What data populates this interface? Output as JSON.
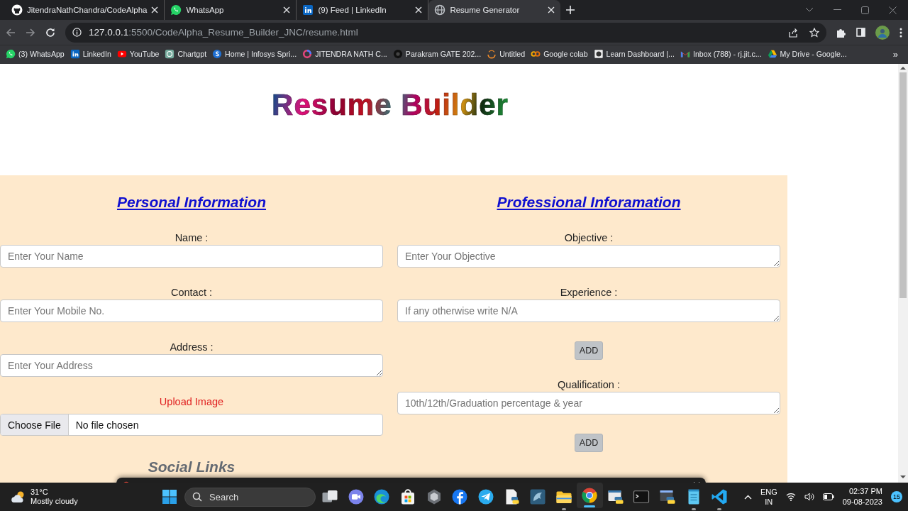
{
  "browser": {
    "tabs": [
      {
        "title": "JitendraNathChandra/CodeAlpha",
        "kind": "github",
        "selected": false
      },
      {
        "title": "WhatsApp",
        "kind": "whatsapp",
        "selected": false
      },
      {
        "title": "(9) Feed | LinkedIn",
        "kind": "linkedin",
        "selected": false
      },
      {
        "title": "Resume Generator",
        "kind": "globe",
        "selected": true
      }
    ],
    "address": {
      "host": "127.0.0.1",
      "path": ":5500/CodeAlpha_Resume_Builder_JNC/resume.html"
    },
    "bookmarks": [
      {
        "label": "(3) WhatsApp",
        "kind": "whatsapp"
      },
      {
        "label": "LinkedIn",
        "kind": "linkedin"
      },
      {
        "label": "YouTube",
        "kind": "youtube"
      },
      {
        "label": "Chartgpt",
        "kind": "chatgpt"
      },
      {
        "label": "Home | Infosys Spri...",
        "kind": "infosys"
      },
      {
        "label": "JITENDRA NATH C...",
        "kind": "ring"
      },
      {
        "label": "Parakram GATE 202...",
        "kind": "dark"
      },
      {
        "label": "Untitled",
        "kind": "arc"
      },
      {
        "label": "Google colab",
        "kind": "colab"
      },
      {
        "label": "Learn Dashboard |...",
        "kind": "learn"
      },
      {
        "label": "Inbox (788) - rj.jit.c...",
        "kind": "gmail"
      },
      {
        "label": "My Drive - Google...",
        "kind": "drive"
      }
    ],
    "more": "»"
  },
  "page": {
    "title": "Resume Builder",
    "columns": [
      {
        "heading": "Personal Information",
        "fields": [
          {
            "kind": "input",
            "label": "Name :",
            "placeholder": "Enter Your Name"
          },
          {
            "kind": "input",
            "label": "Contact :",
            "placeholder": "Enter Your Mobile No."
          },
          {
            "kind": "textarea",
            "label": "Address :",
            "placeholder": "Enter Your Address"
          },
          {
            "kind": "file",
            "label": "Upload Image",
            "button": "Choose File",
            "status": "No file chosen"
          }
        ],
        "subheading": "Social Links"
      },
      {
        "heading": "Professional Inforamation",
        "fields": [
          {
            "kind": "textarea",
            "label": "Objective :",
            "placeholder": "Enter Your Objective"
          },
          {
            "kind": "textarea",
            "label": "Experience :",
            "placeholder": "If any otherwise write N/A"
          },
          {
            "kind": "button",
            "text": "ADD"
          },
          {
            "kind": "textarea",
            "label": "Qualification :",
            "placeholder": "10th/12th/Graduation percentage & year"
          },
          {
            "kind": "button",
            "text": "ADD"
          }
        ]
      }
    ]
  },
  "taskbar": {
    "weather": {
      "temp": "31°C",
      "desc": "Mostly cloudy"
    },
    "search": "Search",
    "apps": [
      {
        "kind": "taskview",
        "running": false,
        "active": false
      },
      {
        "kind": "chat",
        "running": false,
        "active": false
      },
      {
        "kind": "edge",
        "running": false,
        "active": false
      },
      {
        "kind": "store",
        "running": false,
        "active": false
      },
      {
        "kind": "hex",
        "running": false,
        "active": false
      },
      {
        "kind": "facebook",
        "running": false,
        "active": false
      },
      {
        "kind": "telegram",
        "running": false,
        "active": false
      },
      {
        "kind": "pydoc",
        "running": false,
        "active": false
      },
      {
        "kind": "dolphin",
        "running": false,
        "active": false
      },
      {
        "kind": "folder",
        "running": true,
        "active": false
      },
      {
        "kind": "chrome",
        "running": true,
        "active": true
      },
      {
        "kind": "python",
        "running": false,
        "active": false
      },
      {
        "kind": "terminal",
        "running": false,
        "active": false
      },
      {
        "kind": "idle",
        "running": false,
        "active": false
      },
      {
        "kind": "notepad",
        "running": true,
        "active": false
      },
      {
        "kind": "vscode",
        "running": true,
        "active": false
      }
    ],
    "tray": {
      "lang": "ENG",
      "region": "IN",
      "time": "02:37 PM",
      "date": "09-08-2023",
      "badge": "15"
    }
  }
}
